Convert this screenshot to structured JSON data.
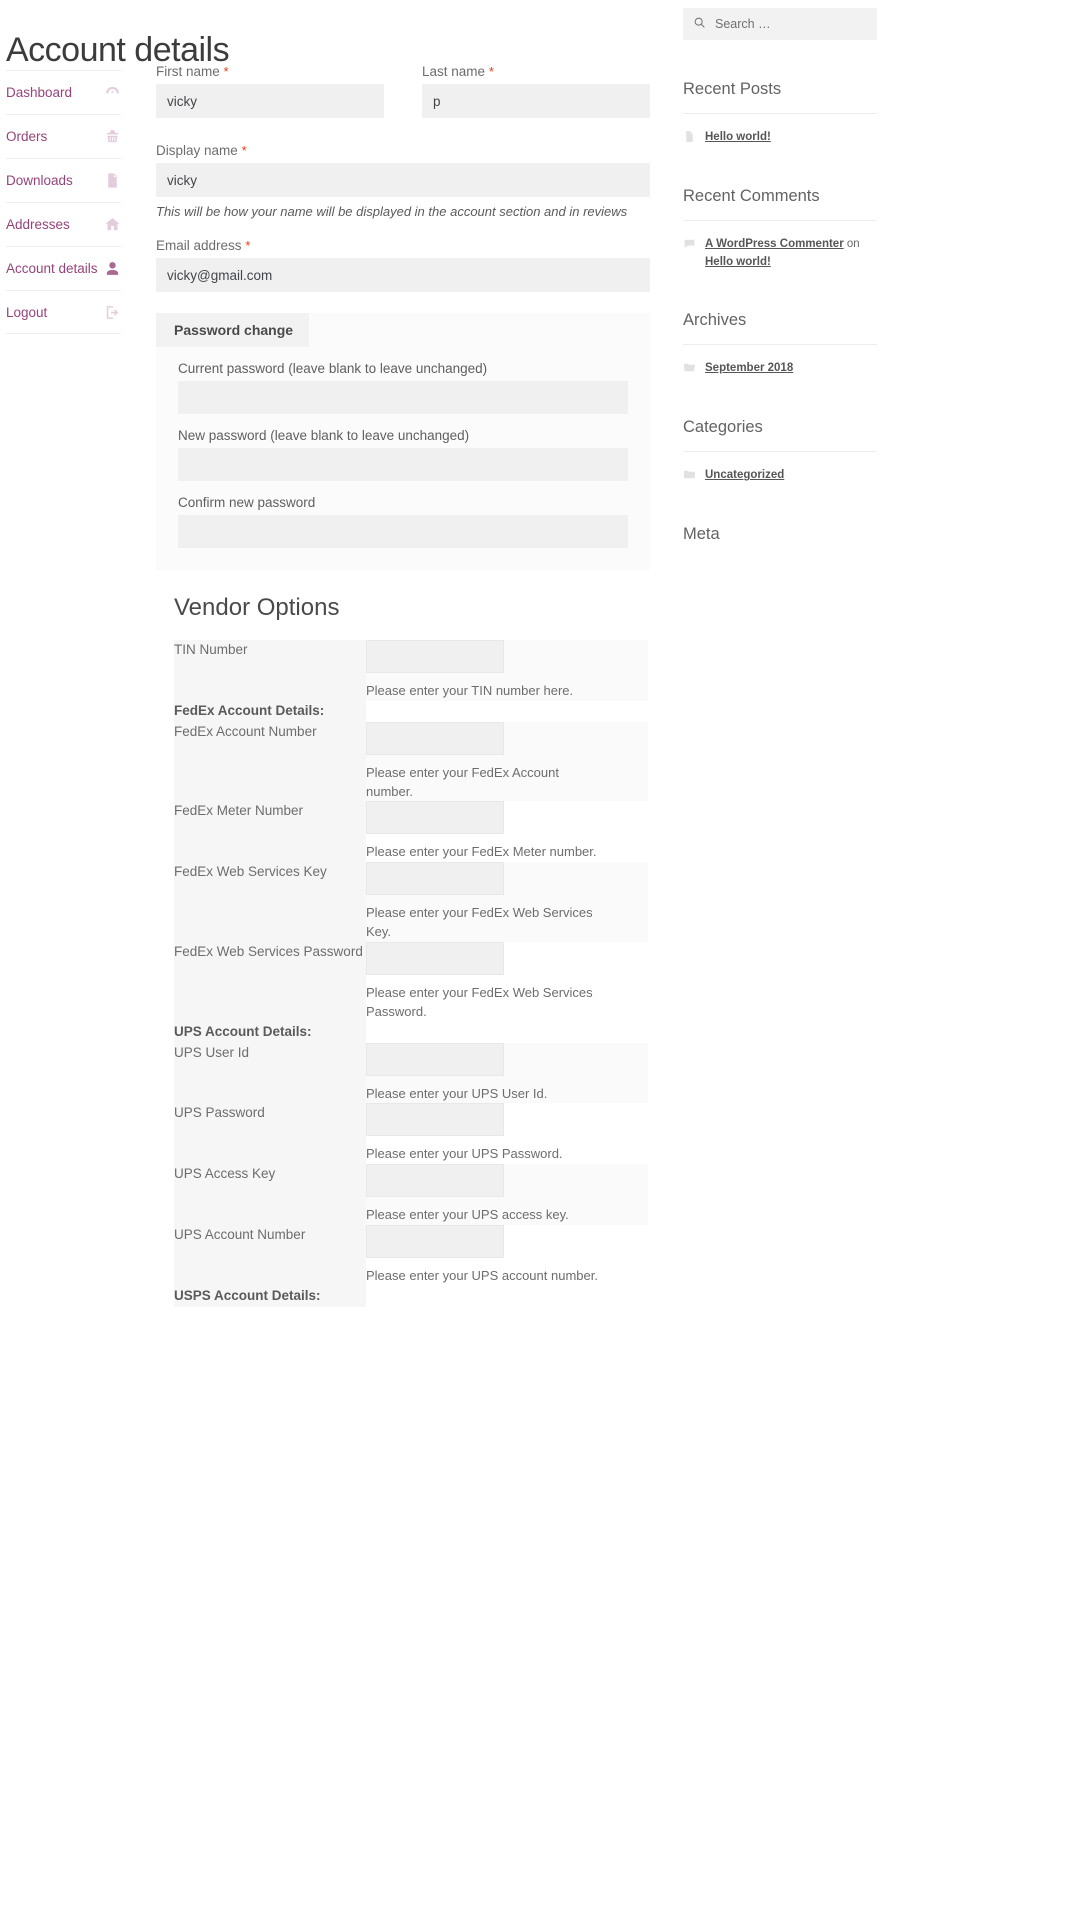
{
  "page": {
    "title": "Account details",
    "vendor_section_title": "Vendor Options"
  },
  "account_nav": {
    "items": [
      {
        "label": "Dashboard",
        "icon": "dashboard-icon"
      },
      {
        "label": "Orders",
        "icon": "basket-icon"
      },
      {
        "label": "Downloads",
        "icon": "file-download-icon"
      },
      {
        "label": "Addresses",
        "icon": "home-icon"
      },
      {
        "label": "Account details",
        "icon": "user-icon"
      },
      {
        "label": "Logout",
        "icon": "logout-icon"
      }
    ]
  },
  "form": {
    "first_name": {
      "label": "First name",
      "required": "*",
      "value": "vicky"
    },
    "last_name": {
      "label": "Last name",
      "required": "*",
      "value": "p"
    },
    "display_name": {
      "label": "Display name",
      "required": "*",
      "value": "vicky",
      "hint": "This will be how your name will be displayed in the account section and in reviews"
    },
    "email": {
      "label": "Email address",
      "required": "*",
      "value": "vicky@gmail.com"
    }
  },
  "password_change": {
    "legend": "Password change",
    "current": {
      "label": "Current password (leave blank to leave unchanged)",
      "value": ""
    },
    "new": {
      "label": "New password (leave blank to leave unchanged)",
      "value": ""
    },
    "confirm": {
      "label": "Confirm new password",
      "value": ""
    }
  },
  "vendor_options": {
    "rows": [
      {
        "label": "TIN Number",
        "type": "input",
        "value": "",
        "hint": "Please enter your TIN number here.",
        "shade": true
      },
      {
        "label": "FedEx Account Details:",
        "type": "header",
        "value": "",
        "hint": "",
        "shade": false
      },
      {
        "label": "FedEx Account Number",
        "type": "input",
        "value": "",
        "hint": "Please enter your FedEx Account number.",
        "shade": true
      },
      {
        "label": "FedEx Meter Number",
        "type": "input",
        "value": "",
        "hint": "Please enter your FedEx Meter number.",
        "shade": false
      },
      {
        "label": "FedEx Web Services Key",
        "type": "input",
        "value": "",
        "hint": "Please enter your FedEx Web Services Key.",
        "shade": true
      },
      {
        "label": "FedEx Web Services Password",
        "type": "input",
        "value": "",
        "hint": "Please enter your FedEx Web Services Password.",
        "shade": false
      },
      {
        "label": "UPS Account Details:",
        "type": "header",
        "value": "",
        "hint": "",
        "shade": false
      },
      {
        "label": "UPS User Id",
        "type": "input",
        "value": "",
        "hint": "Please enter your UPS User Id.",
        "shade": true
      },
      {
        "label": "UPS Password",
        "type": "input",
        "value": "",
        "hint": "Please enter your UPS Password.",
        "shade": false
      },
      {
        "label": "UPS Access Key",
        "type": "input",
        "value": "",
        "hint": "Please enter your UPS access key.",
        "shade": true
      },
      {
        "label": "UPS Account Number",
        "type": "input",
        "value": "",
        "hint": "Please enter your UPS account number.",
        "shade": false
      },
      {
        "label": "USPS Account Details:",
        "type": "header",
        "value": "",
        "hint": "",
        "shade": false
      }
    ]
  },
  "sidebar": {
    "search": {
      "placeholder": "Search …",
      "value": "",
      "icon": "search-icon"
    },
    "widgets": [
      {
        "title": "Recent Posts",
        "items": [
          {
            "icon": "post-icon",
            "link": "Hello world!",
            "suffix": "",
            "link2": ""
          }
        ]
      },
      {
        "title": "Recent Comments",
        "items": [
          {
            "icon": "comment-icon",
            "link": "A WordPress Commenter",
            "suffix": " on ",
            "link2": "Hello world!"
          }
        ]
      },
      {
        "title": "Archives",
        "items": [
          {
            "icon": "folder-open-icon",
            "link": "September 2018",
            "suffix": "",
            "link2": ""
          }
        ]
      },
      {
        "title": "Categories",
        "items": [
          {
            "icon": "folder-icon",
            "link": "Uncategorized",
            "suffix": "",
            "link2": ""
          }
        ]
      },
      {
        "title": "Meta",
        "items": []
      }
    ]
  },
  "colors": {
    "accent": "#96437a",
    "required": "#e2401c",
    "input_bg": "#f0f0f0",
    "text": "#43454b"
  }
}
